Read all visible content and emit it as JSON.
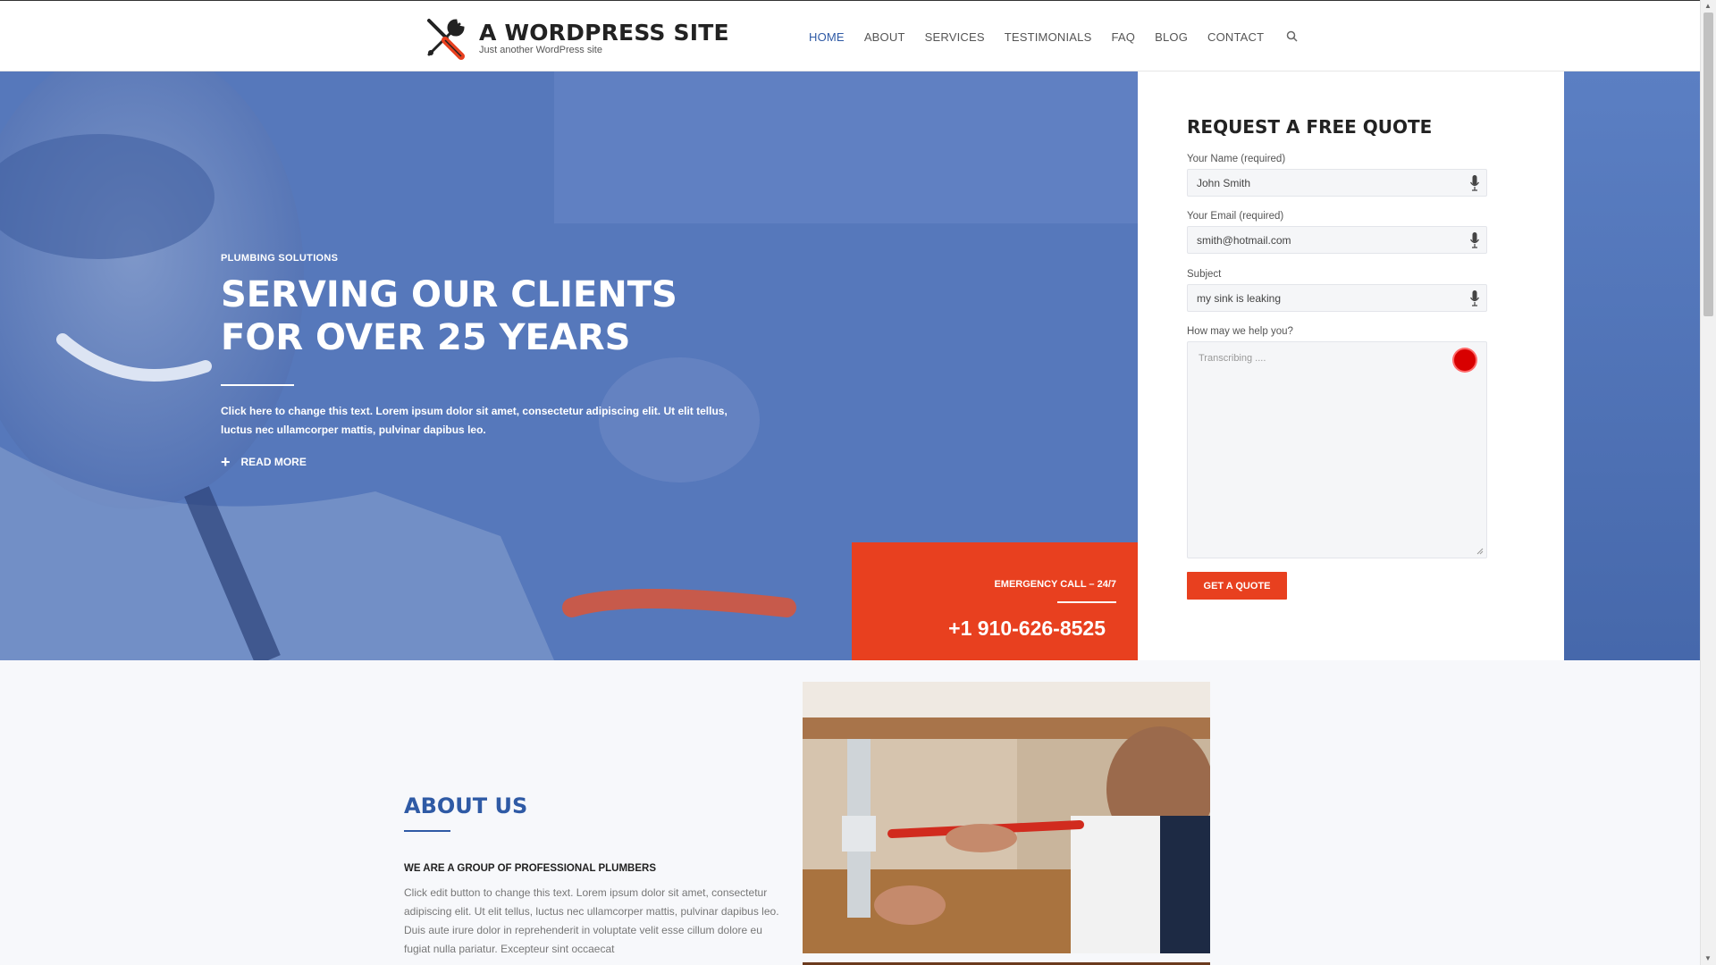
{
  "site": {
    "title": "A WORDPRESS SITE",
    "tagline": "Just another WordPress site"
  },
  "nav": {
    "items": [
      {
        "label": "HOME",
        "active": true
      },
      {
        "label": "ABOUT"
      },
      {
        "label": "SERVICES"
      },
      {
        "label": "TESTIMONIALS"
      },
      {
        "label": "FAQ"
      },
      {
        "label": "BLOG"
      },
      {
        "label": "CONTACT"
      }
    ],
    "search_icon": "search-icon"
  },
  "hero": {
    "subtitle": "PLUMBING SOLUTIONS",
    "title_line1": "SERVING OUR CLIENTS",
    "title_line2": "FOR OVER 25 YEARS",
    "text": "Click here to change this text. Lorem ipsum dolor sit amet, consectetur adipiscing elit. Ut elit tellus, luctus nec ullamcorper mattis, pulvinar dapibus leo.",
    "read_more": "READ MORE",
    "emergency_label": "EMERGENCY CALL – 24/7",
    "phone": "+1 910-626-8525"
  },
  "quote": {
    "title": "REQUEST A FREE QUOTE",
    "name_label": "Your Name (required)",
    "name_value": "John Smith",
    "email_label": "Your Email (required)",
    "email_value": "smith@hotmail.com",
    "subject_label": "Subject",
    "subject_value": "my sink is leaking",
    "message_label": "How may we help you?",
    "message_placeholder": "Transcribing ....",
    "button": "GET A QUOTE"
  },
  "about": {
    "title": "ABOUT US",
    "subtitle": "WE ARE A GROUP OF PROFESSIONAL PLUMBERS",
    "text": "Click edit button to change this text. Lorem ipsum dolor sit amet, consectetur adipiscing elit. Ut elit tellus, luctus nec ullamcorper mattis, pulvinar dapibus leo. Duis aute irure dolor in reprehenderit in voluptate velit esse cillum dolore eu fugiat nulla pariatur. Excepteur sint occaecat"
  },
  "colors": {
    "brand_blue": "#2f5aa5",
    "accent_red": "#e8401f",
    "hero_blue": "#5a7ec1"
  }
}
